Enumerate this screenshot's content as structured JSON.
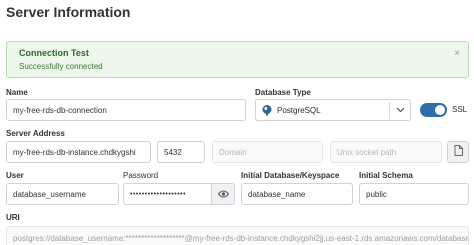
{
  "page": {
    "title": "Server Information"
  },
  "alert": {
    "title": "Connection Test",
    "message": "Successfully connected",
    "close_glyph": "×"
  },
  "name": {
    "label": "Name",
    "value": "my-free-rds-db-connection"
  },
  "database_type": {
    "label": "Database Type",
    "value": "PostgreSQL",
    "icon": "postgresql-elephant-icon"
  },
  "ssl": {
    "label": "SSL",
    "enabled": true,
    "accent": "#2e6fa8"
  },
  "server_address": {
    "label": "Server Address",
    "host": "my-free-rds-db-instance.chdkygshi",
    "port": "5432",
    "domain_placeholder": "Domain",
    "socket_placeholder": "Unix socket path"
  },
  "user": {
    "label": "User",
    "value": "database_username"
  },
  "password": {
    "label": "Password",
    "masked_value": "•••••••••••••••••••"
  },
  "initial_database": {
    "label": "Initial Database/Keyspace",
    "value": "database_name"
  },
  "initial_schema": {
    "label": "Initial Schema",
    "value": "public"
  },
  "uri": {
    "label": "URI",
    "value": "postgres://database_username:*******************@my-free-rds-db-instance.chdkygshi2jj.us-east-1.rds.amazonaws.com/database"
  }
}
